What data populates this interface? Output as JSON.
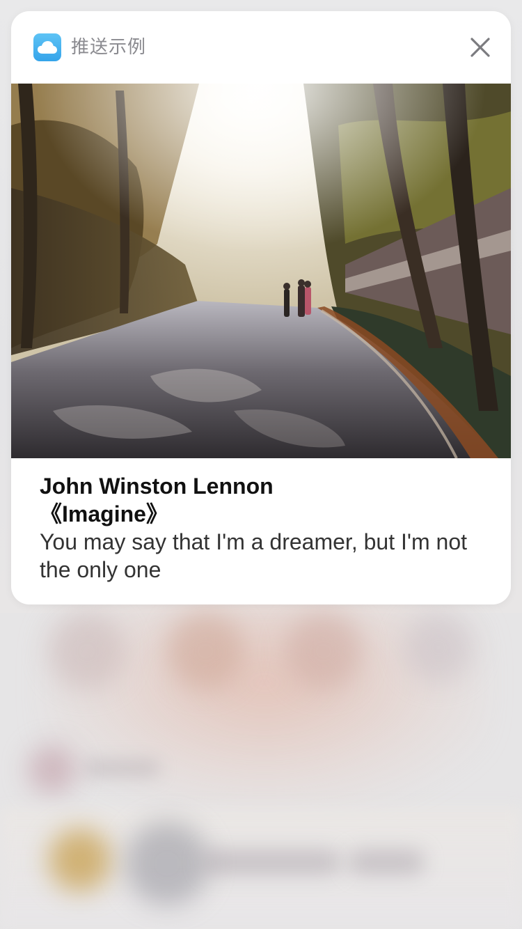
{
  "notification": {
    "app_name": "推送示例",
    "app_icon": "cloud-icon",
    "accent_color": "#3fb0ee",
    "close_icon": "close-icon",
    "title": "John Winston Lennon",
    "subtitle": "《Imagine》",
    "message": "You may say that I'm a dreamer, but I'm not the only one"
  }
}
